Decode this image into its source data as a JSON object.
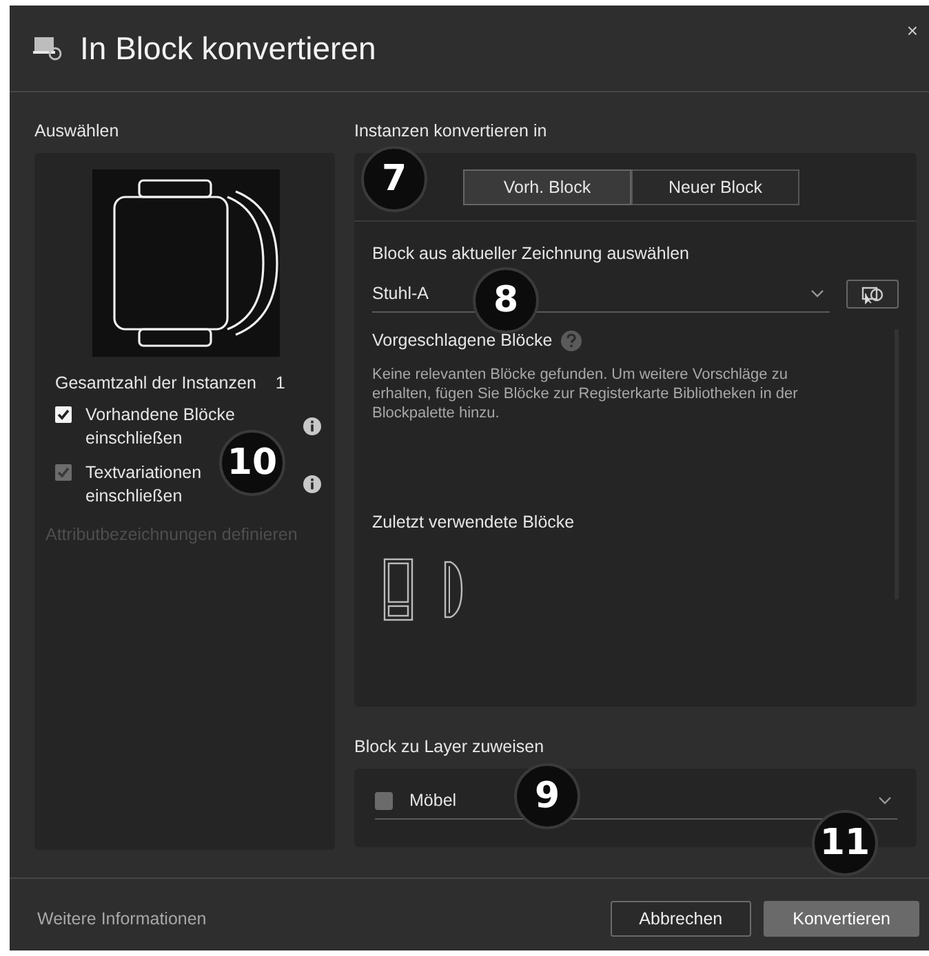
{
  "window": {
    "title": "In Block konvertieren",
    "close": "×"
  },
  "select": {
    "heading": "Auswählen",
    "instance_count_label": "Gesamtzahl der Instanzen",
    "instance_count": "1",
    "callout": "10",
    "options": [
      {
        "label": "Vorhandene Blöcke einschließen",
        "checked": true,
        "disabled": false
      },
      {
        "label": "Textvariationen einschließen",
        "checked": true,
        "disabled": true
      }
    ],
    "attribute_link": "Attributbezeichnungen definieren"
  },
  "convert": {
    "heading": "Instanzen konvertieren in",
    "callout": "7",
    "modes": [
      {
        "label": "Vorh. Block",
        "selected": true
      },
      {
        "label": "Neuer Block",
        "selected": false
      }
    ],
    "block_label": "Block aus aktueller Zeichnung auswählen",
    "block_value": "Stuhl-A",
    "block_callout": "8",
    "suggested_heading": "Vorgeschlagene Blöcke",
    "suggested_message": "Keine relevanten Blöcke gefunden. Um weitere Vorschläge zu erhalten, fügen Sie Blöcke zur Registerkarte Bibliotheken in der Blockpalette hinzu.",
    "recent_heading": "Zuletzt verwendete Blöcke"
  },
  "layer": {
    "heading": "Block zu Layer zuweisen",
    "value": "Möbel",
    "callout": "9"
  },
  "footer": {
    "link": "Weitere Informationen",
    "callout": "11",
    "buttons": [
      {
        "label": "Abbrechen",
        "kind": "secondary"
      },
      {
        "label": "Konvertieren",
        "kind": "primary"
      }
    ]
  }
}
